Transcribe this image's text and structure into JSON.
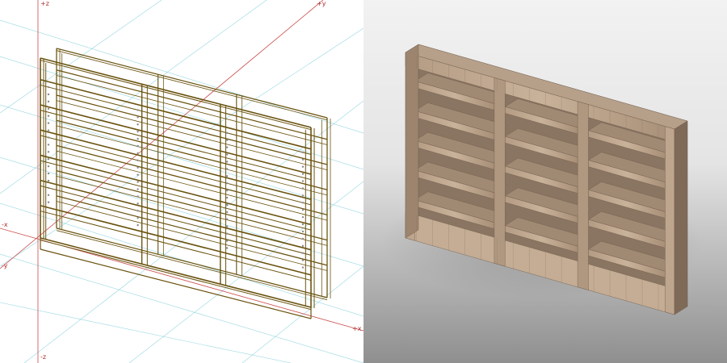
{
  "wireframe_view": {
    "axis_labels": {
      "plus_z": "+z",
      "plus_y": "+y",
      "minus_x": "-x",
      "minus_y": "-y",
      "plus_x": "+x",
      "minus_z": "-z"
    },
    "line_color": "#6b5410",
    "axis_color": "#cc4a4a",
    "grid_color": "#6cc7d4"
  },
  "render_view": {
    "wood_light": "#c4ad94",
    "wood_dark": "#7f6a58",
    "background_top": "#f2f2f2",
    "background_bottom": "#8f8f8f"
  },
  "object": {
    "type": "bookshelf",
    "columns": 3,
    "shelf_levels": 5
  }
}
